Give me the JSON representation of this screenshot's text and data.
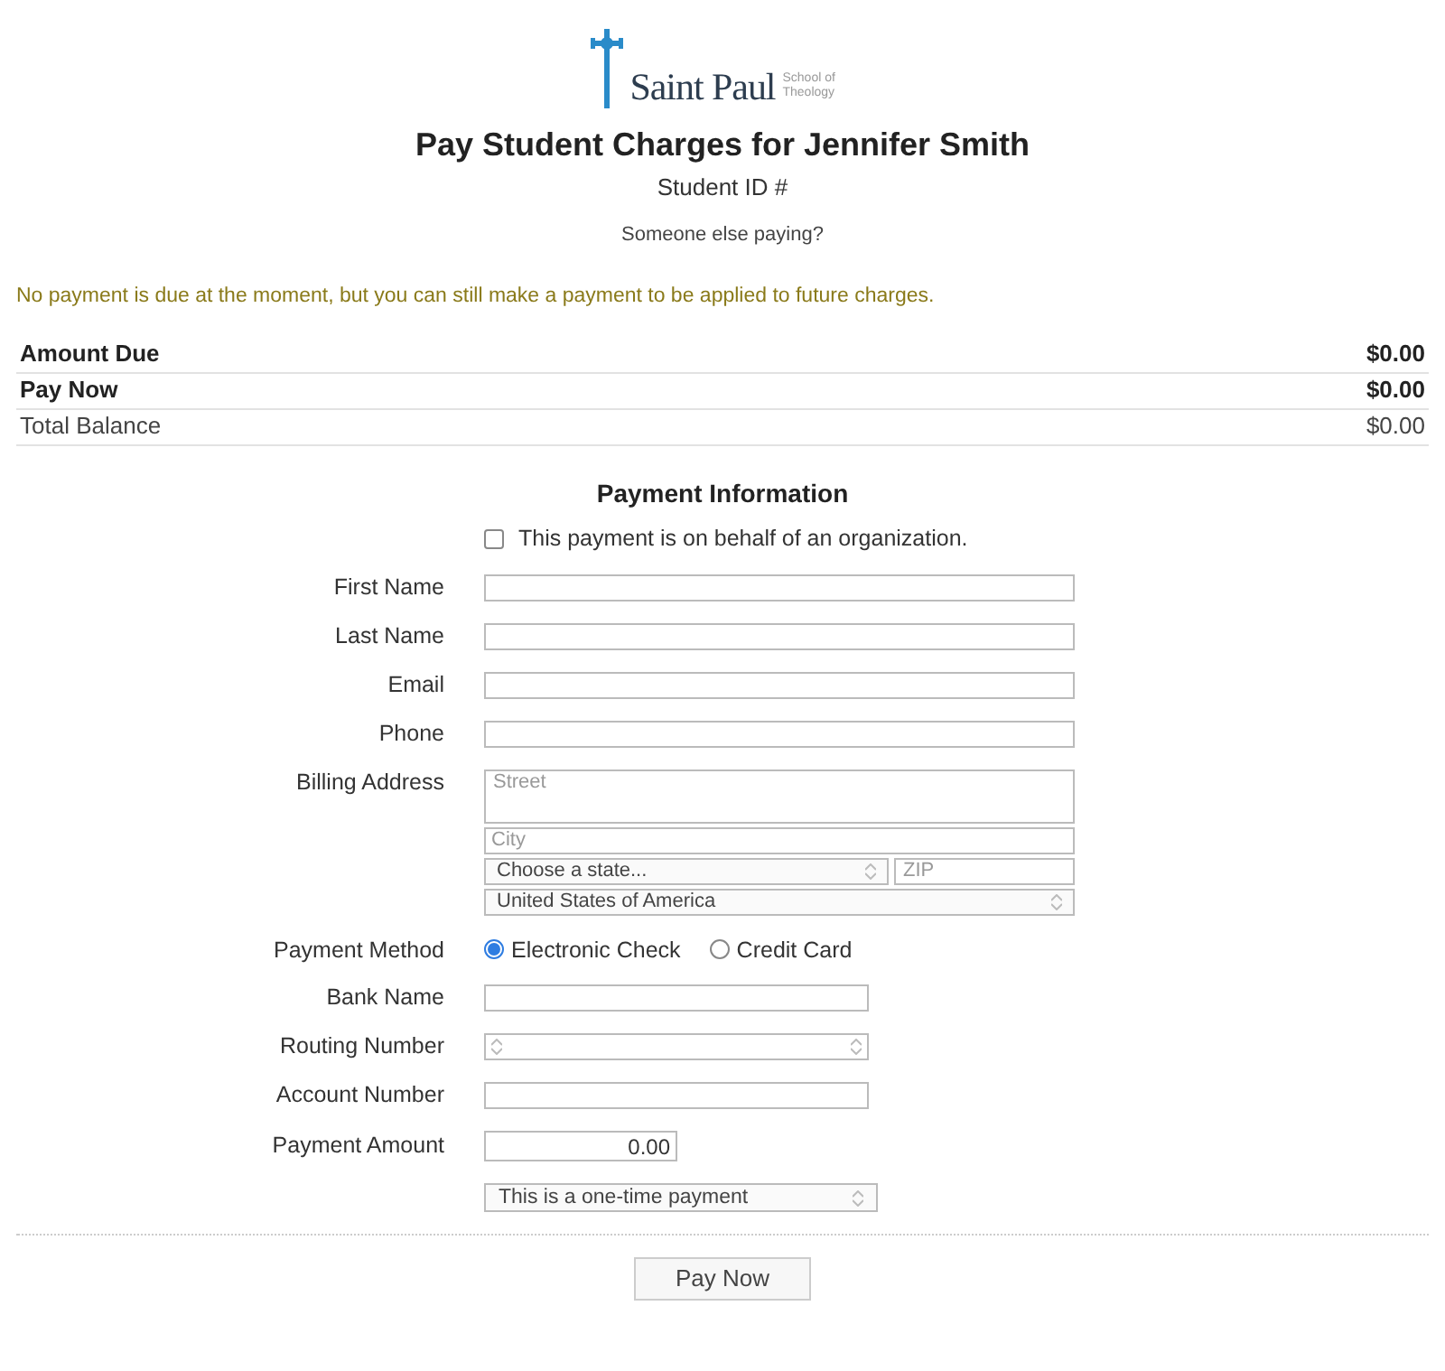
{
  "logo": {
    "name": "Saint Paul",
    "subtitle": "School of Theology"
  },
  "title": "Pay Student Charges for Jennifer Smith",
  "student_id_label": "Student ID #",
  "someone_else_link": "Someone else paying?",
  "notice": "No payment is due at the moment, but you can still make a payment to be applied to future charges.",
  "summary": [
    {
      "label": "Amount Due",
      "value": "$0.00",
      "bold": true
    },
    {
      "label": "Pay Now",
      "value": "$0.00",
      "bold": true
    },
    {
      "label": "Total Balance",
      "value": "$0.00",
      "bold": false
    }
  ],
  "section_title": "Payment Information",
  "organization_checkbox": {
    "label": "This payment is on behalf of an organization.",
    "checked": false
  },
  "contact_fields": [
    {
      "label": "First Name"
    },
    {
      "label": "Last Name"
    },
    {
      "label": "Email"
    },
    {
      "label": "Phone"
    }
  ],
  "billing_address": {
    "label": "Billing Address",
    "street": {
      "placeholder": "Street"
    },
    "city": {
      "placeholder": "City"
    },
    "state": {
      "value": "Choose a state..."
    },
    "zip": {
      "placeholder": "ZIP"
    },
    "country": {
      "value": "United States of America"
    }
  },
  "payment_method": {
    "label": "Payment Method",
    "options": [
      {
        "label": "Electronic Check",
        "selected": true
      },
      {
        "label": "Credit Card",
        "selected": false
      }
    ]
  },
  "bank_fields": [
    {
      "label": "Bank Name",
      "kind": "text"
    },
    {
      "label": "Routing Number",
      "kind": "select"
    },
    {
      "label": "Account Number",
      "kind": "text"
    },
    {
      "label": "Payment Amount",
      "kind": "amount",
      "value": "0.00"
    }
  ],
  "frequency": {
    "value": "This is a one-time payment"
  },
  "submit_button": "Pay Now"
}
